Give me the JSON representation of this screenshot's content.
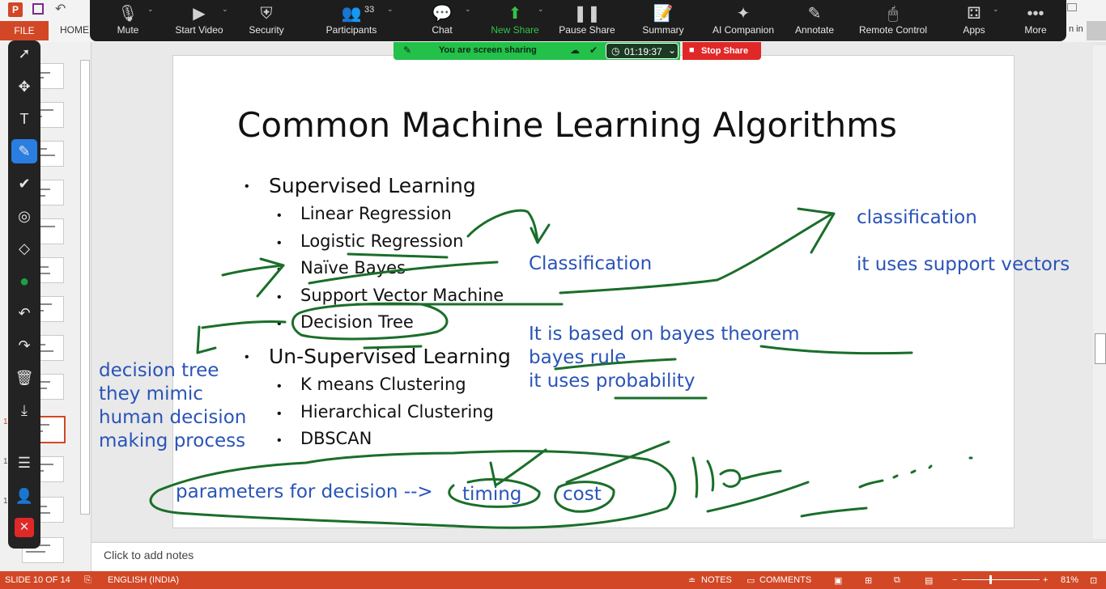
{
  "ppt": {
    "logo": "P",
    "file_tab": "FILE",
    "home_tab": "HOME",
    "signin": "n in",
    "notes_placeholder": "Click to add notes",
    "thumb_numbers": [
      "1",
      "1",
      "1"
    ]
  },
  "status_bar": {
    "slide_info": "SLIDE 10 OF 14",
    "language": "ENGLISH (INDIA)",
    "notes": "NOTES",
    "comments": "COMMENTS",
    "zoom_minus": "−",
    "zoom_plus": "+",
    "zoom": "81%"
  },
  "zoom_toolbar": {
    "items": [
      {
        "label": "Mute",
        "icon": "microphone-icon"
      },
      {
        "label": "Start Video",
        "icon": "video-off-icon"
      },
      {
        "label": "Security",
        "icon": "shield-icon"
      },
      {
        "label": "Participants",
        "icon": "people-icon",
        "count": "33"
      },
      {
        "label": "Chat",
        "icon": "chat-icon"
      },
      {
        "label": "New Share",
        "icon": "share-icon"
      },
      {
        "label": "Pause Share",
        "icon": "pause-icon"
      },
      {
        "label": "Summary",
        "icon": "summary-icon"
      },
      {
        "label": "AI Companion",
        "icon": "sparkle-icon"
      },
      {
        "label": "Annotate",
        "icon": "pencil-icon"
      },
      {
        "label": "Remote Control",
        "icon": "mouse-icon"
      },
      {
        "label": "Apps",
        "icon": "apps-icon"
      },
      {
        "label": "More",
        "icon": "more-icon"
      }
    ],
    "share_notice": "You are screen sharing",
    "timer": "01:19:37",
    "stop_share": "Stop Share"
  },
  "slide": {
    "title": "Common Machine Learning Algorithms",
    "bullets": [
      {
        "text": "Supervised Learning",
        "children": [
          "Linear Regression",
          "Logistic Regression",
          "Naïve Bayes",
          "Support Vector Machine",
          "Decision Tree"
        ]
      },
      {
        "text": "Un-Supervised Learning",
        "children": [
          "K means Clustering",
          "Hierarchical Clustering",
          "DBSCAN"
        ]
      }
    ]
  },
  "annotations": {
    "classification_right": "classification",
    "support_vectors": "it uses support vectors",
    "classification_mid": "Classification",
    "bayes_theorem": "It is based on bayes theorem",
    "bayes_rule": "bayes rule",
    "probability": "it uses probability",
    "decision_tree_note": [
      "decision tree",
      "they mimic",
      "human decision",
      "making process"
    ],
    "parameters": "parameters for decision -->",
    "timing": "timing",
    "cost": "cost"
  },
  "colors": {
    "ppt_orange": "#d24726",
    "zoom_green": "#23c04a",
    "stop_red": "#e02828",
    "ink_green": "#1a6e2a",
    "ink_blue": "#2a54b8"
  }
}
